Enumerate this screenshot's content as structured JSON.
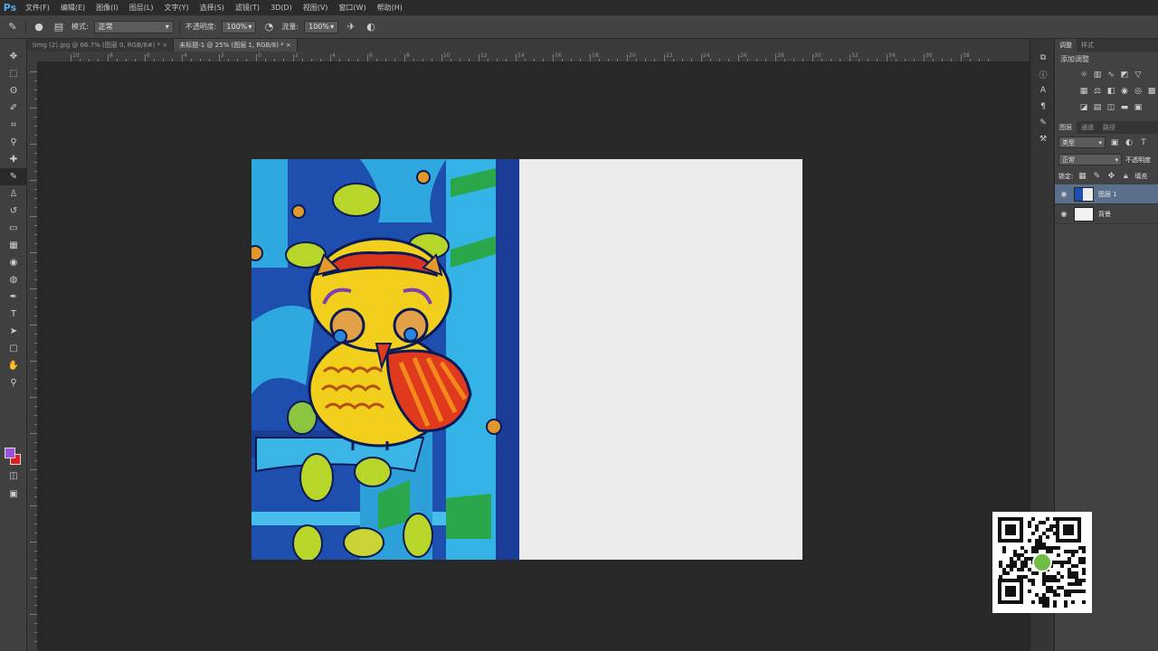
{
  "app": {
    "logo": "Ps"
  },
  "menu": {
    "items": [
      "文件(F)",
      "编辑(E)",
      "图像(I)",
      "图层(L)",
      "文字(Y)",
      "选择(S)",
      "滤镜(T)",
      "3D(D)",
      "视图(V)",
      "窗口(W)",
      "帮助(H)"
    ]
  },
  "options": {
    "mode_label": "模式:",
    "mode_value": "正常",
    "opacity_label": "不透明度:",
    "opacity_value": "100%",
    "flow_label": "流量:",
    "flow_value": "100%"
  },
  "tabs": [
    {
      "label": "timg (2).jpg @ 66.7% (图层 0, RGB/8#) * ×",
      "active": false
    },
    {
      "label": "未标题-1 @ 25% (图层 1, RGB/8) * ×",
      "active": true
    }
  ],
  "ruler": {
    "top_ticks": [
      "10",
      "8",
      "6",
      "4",
      "2",
      "0",
      "2",
      "4",
      "6",
      "8",
      "10",
      "12",
      "14",
      "16",
      "18",
      "20",
      "22",
      "24",
      "26",
      "28",
      "30",
      "32",
      "34",
      "36",
      "38"
    ]
  },
  "panels": {
    "tabs": [
      "调整",
      "样式"
    ],
    "adjust_title": "添加调整",
    "layer_tabs": [
      "图层",
      "通道",
      "路径"
    ],
    "kind_label": "类型",
    "blend_mode": "正常",
    "opacity_label": "不透明度",
    "lock_label": "锁定:",
    "fill_label": "填充",
    "layers": [
      {
        "name": "图层 1",
        "selected": true
      },
      {
        "name": "背景",
        "selected": false
      }
    ]
  },
  "colors": {
    "foreground": "#9b52d9",
    "background": "#e01e1e",
    "canvas": "#ebebeb"
  },
  "icons": {
    "tools": [
      "move-icon",
      "marquee-icon",
      "lasso-icon",
      "quick-select-icon",
      "crop-icon",
      "eyedropper-icon",
      "healing-icon",
      "brush-icon",
      "clone-stamp-icon",
      "history-brush-icon",
      "eraser-icon",
      "gradient-icon",
      "blur-icon",
      "dodge-icon",
      "pen-icon",
      "type-icon",
      "path-select-icon",
      "shape-icon",
      "hand-icon",
      "zoom-icon"
    ]
  }
}
